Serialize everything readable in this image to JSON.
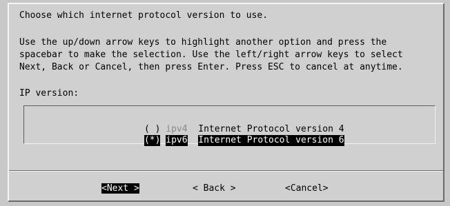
{
  "dialog": {
    "title_line": "Choose which internet protocol version to use.",
    "instructions": [
      "Use the up/down arrow keys to highlight another option and press the",
      "spacebar to make the selection. Use the left/right arrow keys to select",
      "Next, Back or Cancel, then press Enter. Press ESC to cancel at anytime."
    ],
    "list_label": "IP version:"
  },
  "options": [
    {
      "mark": "( )",
      "tag": "ipv4",
      "description": "Internet Protocol version 4",
      "selected": false
    },
    {
      "mark": "(*)",
      "tag": "ipv6",
      "description": "Internet Protocol version 6",
      "selected": true
    }
  ],
  "buttons": {
    "next": {
      "left": "<",
      "hotkey": "N",
      "rest": "ext >"
    },
    "back": "< Back >",
    "cancel": "<Cancel>"
  }
}
